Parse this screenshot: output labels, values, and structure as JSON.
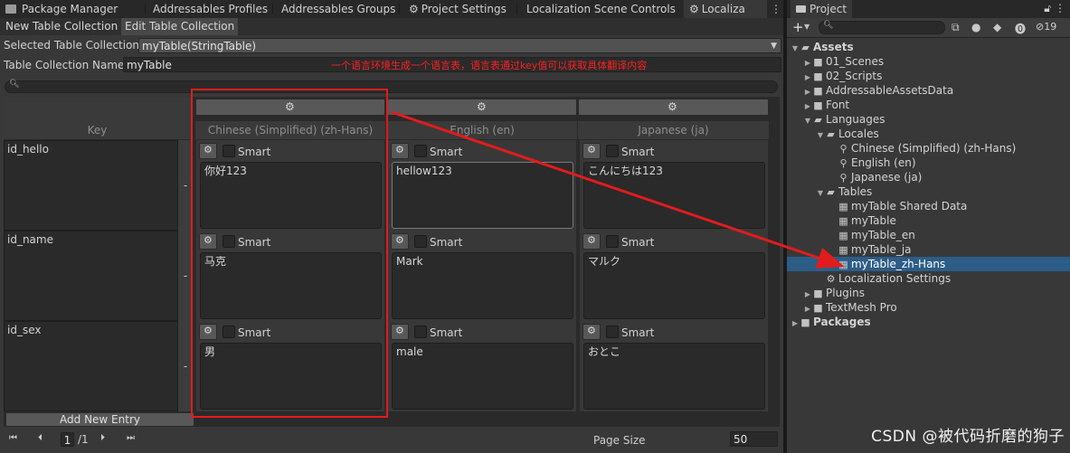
{
  "tabs": {
    "items": [
      "Package Manager",
      "Addressables Profiles",
      "Addressables Groups",
      "Project Settings",
      "Localization Scene Controls",
      "Localiza"
    ],
    "menu_glyph": "⋮"
  },
  "subtabs": [
    "New Table Collection",
    "Edit Table Collection"
  ],
  "form": {
    "selected_label": "Selected Table Collection",
    "selected_value": "myTable(StringTable)",
    "name_label": "Table Collection Name",
    "name_value": "myTable",
    "annotation": "一个语言环境生成一个语言表，语言表通过key值可以获取具体翻译内容"
  },
  "table": {
    "key_header": "Key",
    "columns": [
      "Chinese (Simplified) (zh-Hans)",
      "English (en)",
      "Japanese (ja)"
    ],
    "smart_label": "Smart",
    "dash": "-",
    "rows": [
      {
        "key": "id_hello",
        "values": [
          "你好123",
          "hellow123",
          "こんにちは123"
        ]
      },
      {
        "key": "id_name",
        "values": [
          "马克",
          "Mark",
          "マルク"
        ]
      },
      {
        "key": "id_sex",
        "values": [
          "男",
          "male",
          "おとこ"
        ]
      }
    ],
    "add_entry": "Add New Entry"
  },
  "pager": {
    "page": "1",
    "total": "/1",
    "page_size_label": "Page Size",
    "page_size": "50"
  },
  "project": {
    "title": "Project",
    "hidden_count": "19",
    "tree": [
      {
        "label": "Assets",
        "depth": 0,
        "icon": "folder-open",
        "open": true,
        "bold": true
      },
      {
        "label": "01_Scenes",
        "depth": 1,
        "icon": "folder",
        "open": false
      },
      {
        "label": "02_Scripts",
        "depth": 1,
        "icon": "folder",
        "open": false
      },
      {
        "label": "AddressableAssetsData",
        "depth": 1,
        "icon": "folder",
        "open": false
      },
      {
        "label": "Font",
        "depth": 1,
        "icon": "folder",
        "open": false
      },
      {
        "label": "Languages",
        "depth": 1,
        "icon": "folder-open",
        "open": true
      },
      {
        "label": "Locales",
        "depth": 2,
        "icon": "folder-open",
        "open": true
      },
      {
        "label": "Chinese (Simplified) (zh-Hans)",
        "depth": 3,
        "icon": "locale"
      },
      {
        "label": "English (en)",
        "depth": 3,
        "icon": "locale"
      },
      {
        "label": "Japanese (ja)",
        "depth": 3,
        "icon": "locale"
      },
      {
        "label": "Tables",
        "depth": 2,
        "icon": "folder-open",
        "open": true
      },
      {
        "label": "myTable Shared Data",
        "depth": 3,
        "icon": "table"
      },
      {
        "label": "myTable",
        "depth": 3,
        "icon": "table"
      },
      {
        "label": "myTable_en",
        "depth": 3,
        "icon": "table"
      },
      {
        "label": "myTable_ja",
        "depth": 3,
        "icon": "table"
      },
      {
        "label": "myTable_zh-Hans",
        "depth": 3,
        "icon": "table",
        "selected": true
      },
      {
        "label": "Localization Settings",
        "depth": 2,
        "icon": "settings"
      },
      {
        "label": "Plugins",
        "depth": 1,
        "icon": "folder",
        "open": false
      },
      {
        "label": "TextMesh Pro",
        "depth": 1,
        "icon": "folder",
        "open": false
      },
      {
        "label": "Packages",
        "depth": 0,
        "icon": "folder",
        "open": false,
        "bold": true
      }
    ]
  },
  "watermark": "CSDN @被代码折磨的狗子",
  "colors": {
    "annotation": "#ff2020",
    "selection": "#2c5d87",
    "panel": "#383838"
  }
}
